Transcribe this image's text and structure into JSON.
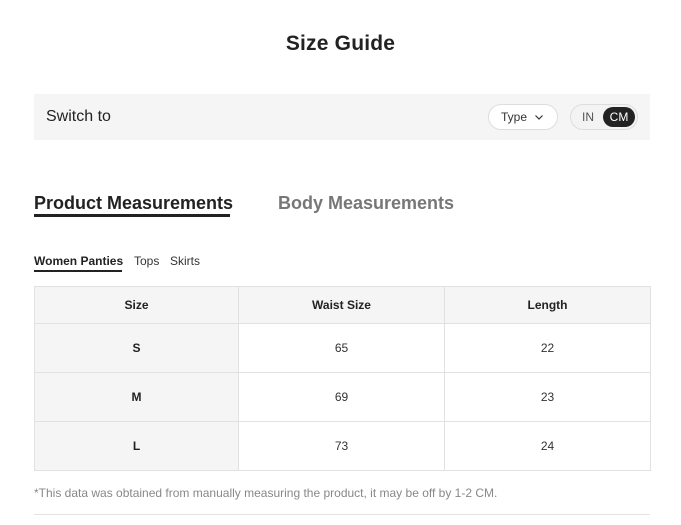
{
  "page": {
    "title": "Size Guide"
  },
  "switch_bar": {
    "label": "Switch to",
    "type_dropdown": {
      "selected": "Type"
    },
    "units": {
      "in_label": "IN",
      "cm_label": "CM",
      "active": "CM"
    }
  },
  "main_tabs": [
    {
      "label": "Product Measurements",
      "active": true
    },
    {
      "label": "Body Measurements",
      "active": false
    }
  ],
  "sub_tabs": [
    {
      "label": "Women Panties",
      "active": true
    },
    {
      "label": "Tops",
      "active": false
    },
    {
      "label": "Skirts",
      "active": false
    }
  ],
  "table": {
    "headers": [
      "Size",
      "Waist Size",
      "Length"
    ],
    "rows": [
      [
        "S",
        "65",
        "22"
      ],
      [
        "M",
        "69",
        "23"
      ],
      [
        "L",
        "73",
        "24"
      ]
    ]
  },
  "note": "*This data was obtained from manually measuring the product, it may be off by 1-2 CM.",
  "colors": {
    "accent": "#222222",
    "panel_bg": "#f5f5f5",
    "inactive_tab": "#777777",
    "note_text": "#888888"
  }
}
